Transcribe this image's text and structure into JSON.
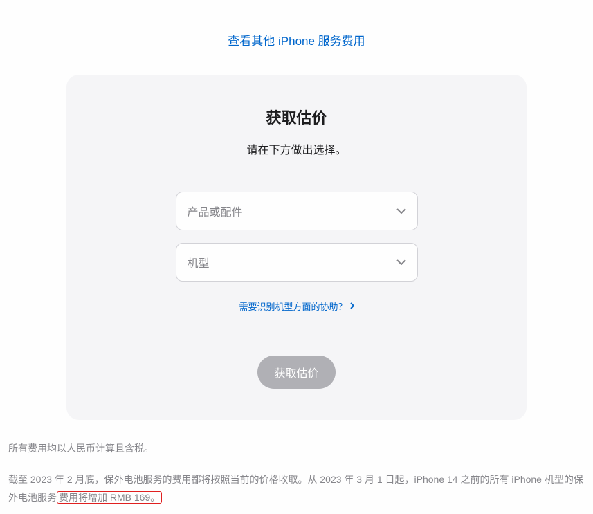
{
  "topLink": "查看其他 iPhone 服务费用",
  "card": {
    "title": "获取估价",
    "subtitle": "请在下方做出选择。",
    "select1Placeholder": "产品或配件",
    "select2Placeholder": "机型",
    "helpLink": "需要识别机型方面的协助？",
    "actionBtn": "获取估价"
  },
  "footer": {
    "para1": "所有费用均以人民币计算且含税。",
    "para2_part1": "截至 2023 年 2 月底，保外电池服务的费用都将按照当前的价格收取。从 2023 年 3 月 1 日起，iPhone 14 之前的所有 iPhone 机型的保外电池服务",
    "para2_highlight": "费用将增加 RMB 169。"
  }
}
